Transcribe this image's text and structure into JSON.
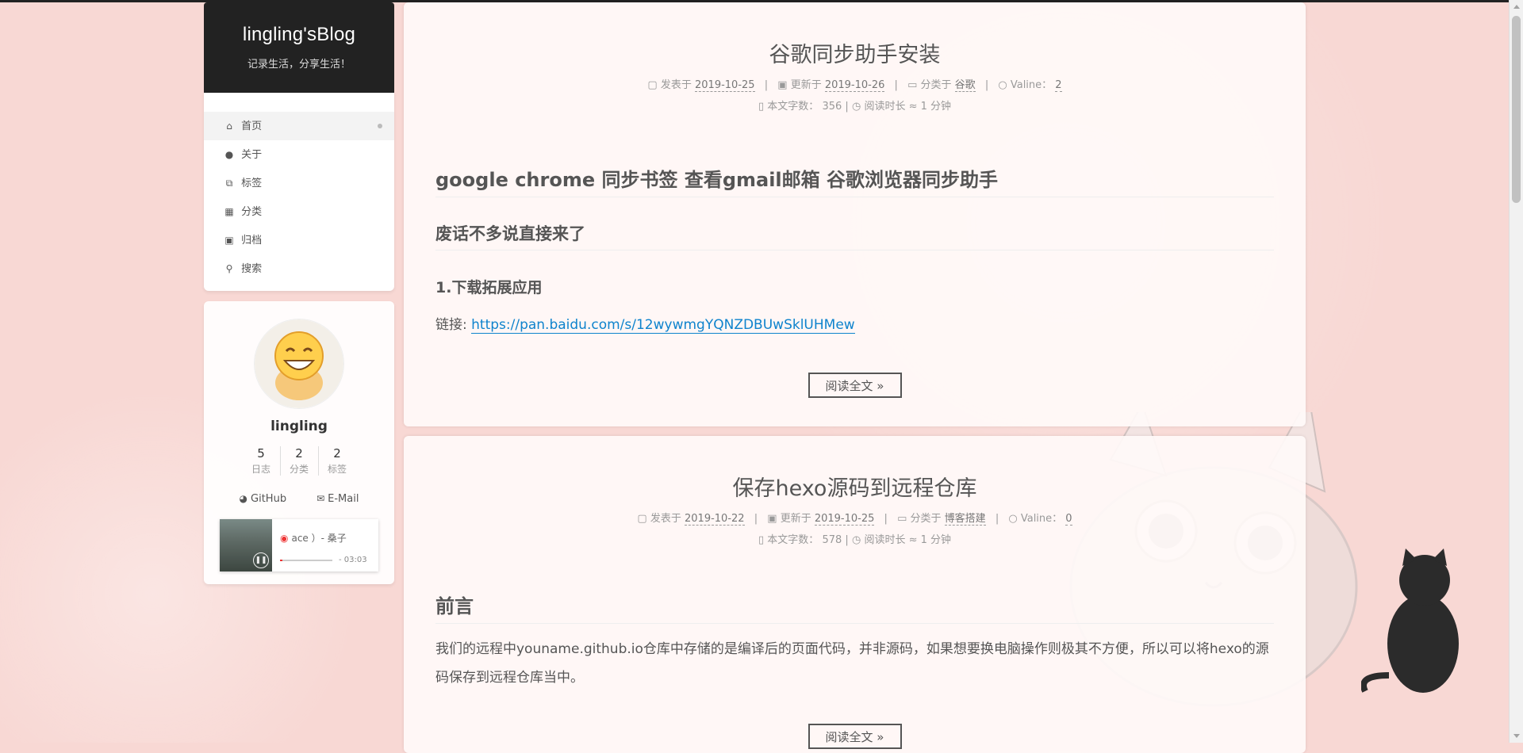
{
  "site": {
    "title": "lingling'sBlog",
    "subtitle": "记录生活，分享生活！"
  },
  "menu": [
    {
      "label": "首页",
      "icon": "home-icon",
      "glyph": "⌂"
    },
    {
      "label": "关于",
      "icon": "user-icon",
      "glyph": "●"
    },
    {
      "label": "标签",
      "icon": "tags-icon",
      "glyph": "⧉"
    },
    {
      "label": "分类",
      "icon": "th-icon",
      "glyph": "▦"
    },
    {
      "label": "归档",
      "icon": "archive-icon",
      "glyph": "▣"
    },
    {
      "label": "搜索",
      "icon": "search-icon",
      "glyph": "⚲"
    }
  ],
  "profile": {
    "name": "lingling",
    "stats": [
      {
        "num": "5",
        "label": "日志"
      },
      {
        "num": "2",
        "label": "分类"
      },
      {
        "num": "2",
        "label": "标签"
      }
    ],
    "links": [
      {
        "label": "GitHub",
        "icon": "github-icon"
      },
      {
        "label": "E-Mail",
        "icon": "envelope-icon"
      }
    ]
  },
  "player": {
    "song": "ace ）- 桑子",
    "time": "- 03:03",
    "progress": 0.05
  },
  "posts": [
    {
      "title": "谷歌同步助手安装",
      "published_label": "发表于",
      "published": "2019-10-25",
      "updated_label": "更新于",
      "updated": "2019-10-26",
      "category_label": "分类于",
      "category": "谷歌",
      "comments_label": "Valine：",
      "comments": "2",
      "words_label": "本文字数：",
      "words": "356",
      "readtime": "阅读时长 ≈ 1 分钟",
      "h1": "google chrome 同步书签 查看gmail邮箱 谷歌浏览器同步助手",
      "h2": "废话不多说直接来了",
      "h3": "1.下载拓展应用",
      "link_prefix": "链接: ",
      "link": "https://pan.baidu.com/s/12wywmgYQNZDBUwSklUHMew",
      "readmore": "阅读全文 »"
    },
    {
      "title": "保存hexo源码到远程仓库",
      "published_label": "发表于",
      "published": "2019-10-22",
      "updated_label": "更新于",
      "updated": "2019-10-25",
      "category_label": "分类于",
      "category": "博客搭建",
      "comments_label": "Valine：",
      "comments": "0",
      "words_label": "本文字数：",
      "words": "578",
      "readtime": "阅读时长 ≈ 1 分钟",
      "h1": "前言",
      "para": "我们的远程中youname.github.io仓库中存储的是编译后的页面代码，并非源码，如果想要换电脑操作则极其不方便，所以可以将hexo的源码保存到远程仓库当中。",
      "readmore": "阅读全文 »"
    }
  ]
}
